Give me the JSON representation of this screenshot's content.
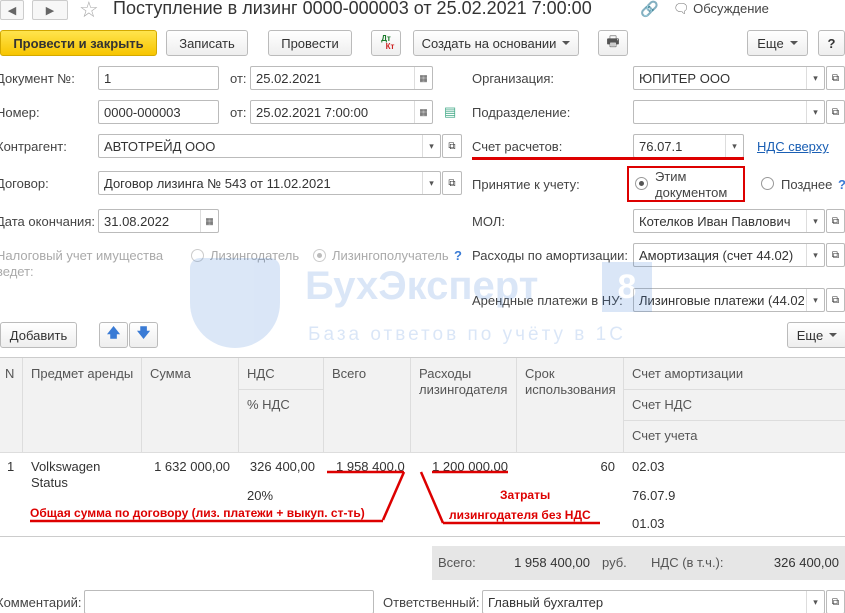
{
  "window": {
    "title": "Поступление в лизинг 0000-000003 от 25.02.2021 7:00:00",
    "discussion_label": "Обсуждение"
  },
  "toolbar": {
    "post_close": "Провести и закрыть",
    "save": "Записать",
    "post": "Провести",
    "create_basis": "Создать на основании",
    "more": "Еще",
    "help": "?",
    "dtkt_top": "Дт",
    "dtkt_bottom": "Кт"
  },
  "form": {
    "doc_no_label": "Документ №:",
    "doc_no_value": "1",
    "from_label": "от:",
    "doc_date": "25.02.2021",
    "number_label": "Номер:",
    "number_value": "0000-000003",
    "from_label2": "от:",
    "number_date": "25.02.2021  7:00:00",
    "counterparty_label": "Контрагент:",
    "counterparty_value": "АВТОТРЕЙД ООО",
    "contract_label": "Договор:",
    "contract_value": "Договор лизинга № 543 от 11.02.2021",
    "end_date_label": "Дата окончания:",
    "end_date_value": "31.08.2022",
    "tax_label_1": "Налоговый учет имущества",
    "tax_label_2": "ведет:",
    "tax_opt_lessor": "Лизингодатель",
    "tax_opt_lessee": "Лизингополучатель",
    "help_mark": "?",
    "org_label": "Организация:",
    "org_value": "ЮПИТЕР ООО",
    "dept_label": "Подразделение:",
    "dept_value": "",
    "account_label": "Счет расчетов:",
    "account_value": "76.07.1",
    "vat_link": "НДС сверху",
    "accept_label": "Принятие к учету:",
    "accept_opt1_l1": "Этим",
    "accept_opt1_l2": "документом",
    "accept_opt2": "Позднее",
    "mol_label": "МОЛ:",
    "mol_value": "Котелков Иван Павлович",
    "amort_label": "Расходы по амортизации:",
    "amort_value": "Амортизация (счет 44.02)",
    "rent_label": "Арендные платежи в НУ:",
    "rent_value": "Лизинговые платежи (44.02"
  },
  "table_toolbar": {
    "add": "Добавить",
    "more": "Еще"
  },
  "table": {
    "headers": {
      "n": "N",
      "subject": "Предмет аренды",
      "sum": "Сумма",
      "vat": "НДС",
      "vat_pct": "% НДС",
      "total": "Всего",
      "lessee_exp_1": "Расходы",
      "lessee_exp_2": "лизингодателя",
      "term_1": "Срок",
      "term_2": "использования",
      "acc_amort": "Счет амортизации",
      "acc_vat": "Счет НДС",
      "acc_acct": "Счет учета"
    },
    "rows": [
      {
        "n": "1",
        "subject_1": "Volkswagen",
        "subject_2": "Status",
        "sum": "1 632 000,00",
        "vat": "326 400,00",
        "vat_pct": "20%",
        "total": "1 958 400,0",
        "lessee_exp": "1 200 000,00",
        "term": "60",
        "acc_amort": "02.03",
        "acc_vat": "76.07.9",
        "acc_acct": "01.03"
      }
    ]
  },
  "annotations": {
    "total_note": "Общая сумма по договору (лиз. платежи  + выкуп. ст-ть)",
    "cost_note_1": "Затраты",
    "cost_note_2": "лизингодателя без НДС"
  },
  "footer": {
    "total_label": "Всего:",
    "total_value": "1 958 400,00",
    "currency": "руб.",
    "vat_label": "НДС (в т.ч.):",
    "vat_value": "326 400,00",
    "comment_label": "Комментарий:",
    "responsible_label": "Ответственный:",
    "responsible_value": "Главный бухгалтер"
  },
  "watermark": {
    "brand": "БухЭксперт",
    "digit": "8",
    "tagline": "База ответов по учёту в 1С"
  },
  "colors": {
    "accent_red": "#d00000",
    "primary_yellow": "#f7c500",
    "link_blue": "#1a5fb4"
  }
}
